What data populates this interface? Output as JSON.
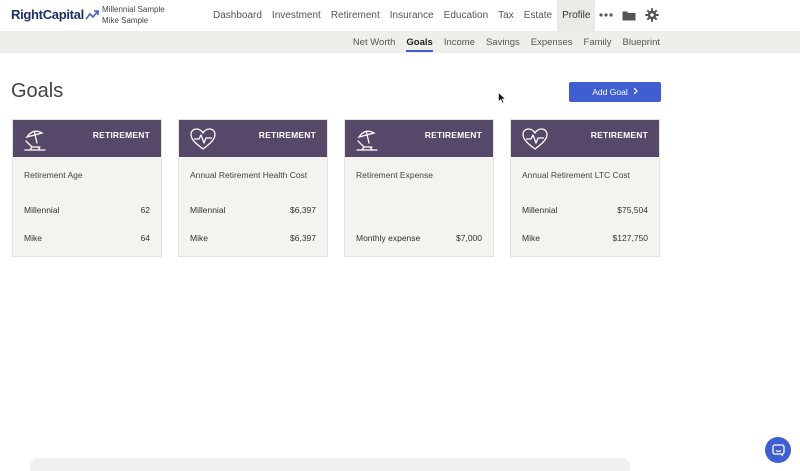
{
  "brand": {
    "name": "RightCapital"
  },
  "clients": [
    "Millennial Sample",
    "Mike Sample"
  ],
  "main_nav": [
    {
      "label": "Dashboard",
      "active": false
    },
    {
      "label": "Investment",
      "active": false
    },
    {
      "label": "Retirement",
      "active": false
    },
    {
      "label": "Insurance",
      "active": false
    },
    {
      "label": "Education",
      "active": false
    },
    {
      "label": "Tax",
      "active": false
    },
    {
      "label": "Estate",
      "active": false
    },
    {
      "label": "Profile",
      "active": true
    }
  ],
  "toolbar_icons": [
    "more-icon",
    "folder-icon",
    "gear-icon"
  ],
  "sub_nav": [
    {
      "label": "Net Worth",
      "active": false
    },
    {
      "label": "Goals",
      "active": true
    },
    {
      "label": "Income",
      "active": false
    },
    {
      "label": "Savings",
      "active": false
    },
    {
      "label": "Expenses",
      "active": false
    },
    {
      "label": "Family",
      "active": false
    },
    {
      "label": "Blueprint",
      "active": false
    }
  ],
  "page": {
    "title": "Goals",
    "add_button": "Add Goal"
  },
  "colors": {
    "accent": "#3f5ed1",
    "card_header": "#564868",
    "card_bg": "#f4f3f0",
    "brand": "#1c2f6b"
  },
  "cards": [
    {
      "category": "RETIREMENT",
      "icon": "beach-chair-icon",
      "title": "Retirement Age",
      "rows": [
        {
          "label": "Millennial",
          "value": "62"
        },
        {
          "label": "Mike",
          "value": "64"
        }
      ]
    },
    {
      "category": "RETIREMENT",
      "icon": "heart-pulse-icon",
      "title": "Annual Retirement Health Cost",
      "rows": [
        {
          "label": "Millennial",
          "value": "$6,397"
        },
        {
          "label": "Mike",
          "value": "$6,397"
        }
      ]
    },
    {
      "category": "RETIREMENT",
      "icon": "beach-chair-icon",
      "title": "Retirement Expense",
      "rows": [
        {
          "label": "",
          "value": ""
        },
        {
          "label": "Monthly expense",
          "value": "$7,000"
        }
      ]
    },
    {
      "category": "RETIREMENT",
      "icon": "heart-pulse-icon",
      "title": "Annual Retirement LTC Cost",
      "rows": [
        {
          "label": "Millennial",
          "value": "$75,504"
        },
        {
          "label": "Mike",
          "value": "$127,750"
        }
      ]
    }
  ]
}
